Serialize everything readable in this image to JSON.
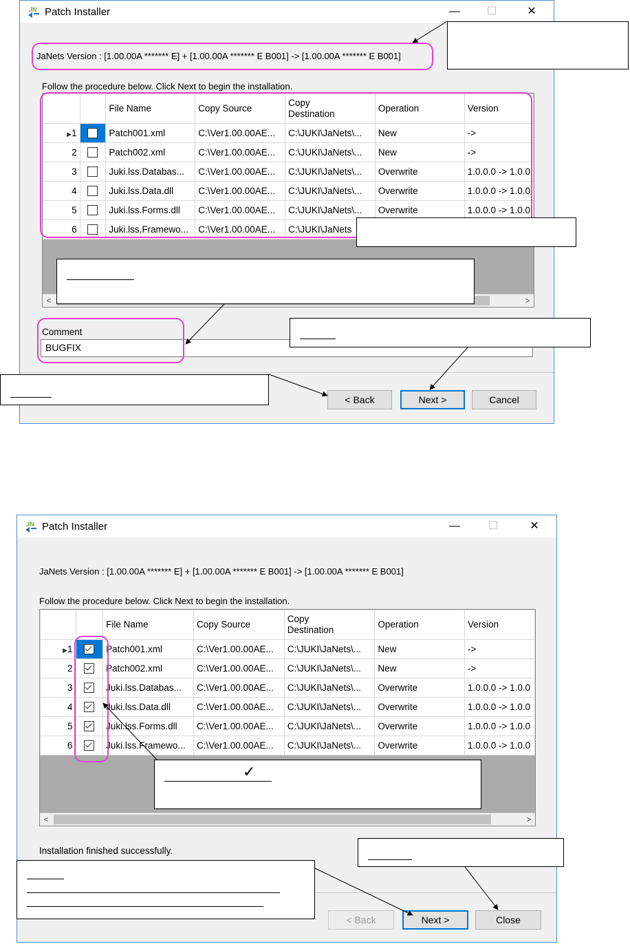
{
  "window1": {
    "title": "Patch Installer",
    "minimize": "—",
    "maximize": "☐",
    "close": "✕",
    "version_line": "JaNets Version : [1.00.00A ******* E] + [1.00.00A ******* E B001] -> [1.00.00A ******* E B001]",
    "instruction": "Follow the procedure below. Click Next to begin the installation.",
    "columns": [
      "File Name",
      "Copy Source",
      "Copy\nDestination",
      "Operation",
      "Version"
    ],
    "rows": [
      {
        "num": "1",
        "checked": false,
        "file": "Patch001.xml",
        "src": "C:\\Ver1.00.00AE...",
        "dst": "C:\\JUKI\\JaNets\\...",
        "op": "New",
        "ver": "->"
      },
      {
        "num": "2",
        "checked": false,
        "file": "Patch002.xml",
        "src": "C:\\Ver1.00.00AE...",
        "dst": "C:\\JUKI\\JaNets\\...",
        "op": "New",
        "ver": "->"
      },
      {
        "num": "3",
        "checked": false,
        "file": "Juki.lss.Databas...",
        "src": "C:\\Ver1.00.00AE...",
        "dst": "C:\\JUKI\\JaNets\\...",
        "op": "Overwrite",
        "ver": "1.0.0.0 -> 1.0.0"
      },
      {
        "num": "4",
        "checked": false,
        "file": "Juki.lss.Data.dll",
        "src": "C:\\Ver1.00.00AE...",
        "dst": "C:\\JUKI\\JaNets\\...",
        "op": "Overwrite",
        "ver": "1.0.0.0 -> 1.0.0"
      },
      {
        "num": "5",
        "checked": false,
        "file": "Juki.lss.Forms.dll",
        "src": "C:\\Ver1.00.00AE...",
        "dst": "C:\\JUKI\\JaNets\\...",
        "op": "Overwrite",
        "ver": "1.0.0.0 -> 1.0.0"
      },
      {
        "num": "6",
        "checked": false,
        "file": "Juki.lss.Framewo...",
        "src": "C:\\Ver1.00.00AE...",
        "dst": "C:\\JUKI\\JaNets",
        "op": "",
        "ver": ""
      }
    ],
    "comment_label": "Comment",
    "comment_value": "BUGFIX",
    "back_label": "< Back",
    "next_label": "Next >",
    "cancel_label": "Cancel"
  },
  "window2": {
    "title": "Patch Installer",
    "minimize": "—",
    "maximize": "☐",
    "close": "✕",
    "version_line": "JaNets Version : [1.00.00A ******* E] + [1.00.00A ******* E B001] -> [1.00.00A ******* E B001]",
    "instruction": "Follow the procedure below. Click Next to begin the installation.",
    "columns": [
      "File Name",
      "Copy Source",
      "Copy\nDestination",
      "Operation",
      "Version"
    ],
    "rows": [
      {
        "num": "1",
        "checked": true,
        "file": "Patch001.xml",
        "src": "C:\\Ver1.00.00AE...",
        "dst": "C:\\JUKI\\JaNets\\...",
        "op": "New",
        "ver": "->"
      },
      {
        "num": "2",
        "checked": true,
        "file": "Patch002.xml",
        "src": "C:\\Ver1.00.00AE...",
        "dst": "C:\\JUKI\\JaNets\\...",
        "op": "New",
        "ver": "->"
      },
      {
        "num": "3",
        "checked": true,
        "file": "Juki.lss.Databas...",
        "src": "C:\\Ver1.00.00AE...",
        "dst": "C:\\JUKI\\JaNets\\...",
        "op": "Overwrite",
        "ver": "1.0.0.0 -> 1.0.0"
      },
      {
        "num": "4",
        "checked": true,
        "file": "Juki.lss.Data.dll",
        "src": "C:\\Ver1.00.00AE...",
        "dst": "C:\\JUKI\\JaNets\\...",
        "op": "Overwrite",
        "ver": "1.0.0.0 -> 1.0.0"
      },
      {
        "num": "5",
        "checked": true,
        "file": "Juki.lss.Forms.dll",
        "src": "C:\\Ver1.00.00AE...",
        "dst": "C:\\JUKI\\JaNets\\...",
        "op": "Overwrite",
        "ver": "1.0.0.0 -> 1.0.0"
      },
      {
        "num": "6",
        "checked": true,
        "file": "Juki.lss.Framewo...",
        "src": "C:\\Ver1.00.00AE...",
        "dst": "C:\\JUKI\\JaNets\\...",
        "op": "Overwrite",
        "ver": "1.0.0.0 -> 1.0.0"
      }
    ],
    "status": "Installation finished successfully.",
    "back_label": "< Back",
    "next_label": "Next >",
    "close_label": "Close"
  },
  "callouts": {
    "checkmark": "✓"
  },
  "colors": {
    "highlight": "#e83fd6",
    "selection": "#0078d7",
    "window_bg": "#f0f0f0",
    "grid_empty": "#ababab"
  }
}
